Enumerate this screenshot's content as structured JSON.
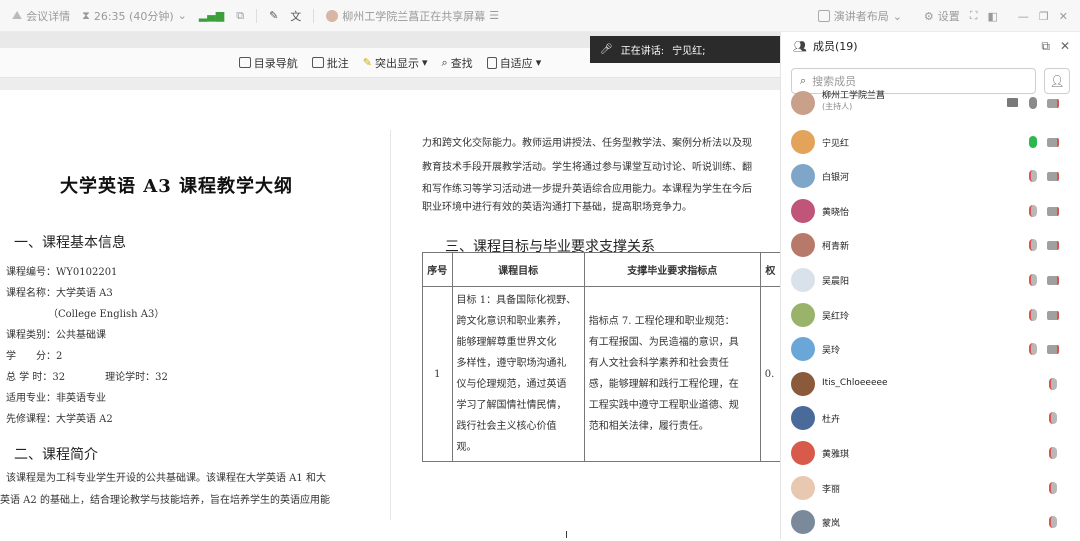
{
  "topbar": {
    "meeting_details": "会议详情",
    "timer": "26:35 (40分钟)",
    "sharing_status": "柳州工学院兰菖正在共享屏幕",
    "presenter_layout": "演讲者布局",
    "settings": "设置"
  },
  "doc_toolbar": {
    "nav": "目录导航",
    "annotate": "批注",
    "highlight": "突出显示",
    "find": "查找",
    "fit": "自适应"
  },
  "speaking": {
    "label": "正在讲话:",
    "name": "宁见红;"
  },
  "document": {
    "title": "大学英语 A3 课程教学大纲",
    "section1": "一、课程基本信息",
    "code": "课程编号：WY0102201",
    "name": "课程名称：大学英语 A3",
    "name_en": "（College English A3）",
    "category": "课程类别：公共基础课",
    "credits": "学　　分：2",
    "hours": "总 学 时：32　　　　理论学时：32",
    "major": "适用专业：非英语专业",
    "prereq": "先修课程：大学英语 A2",
    "section2": "二、课程简介",
    "intro1": "该课程是为工科专业学生开设的公共基础课。该课程在大学英语 A1 和大",
    "intro2": "英语 A2 的基础上，结合理论教学与技能培养，旨在培养学生的英语应用能",
    "right1": "力和跨文化交际能力。教师运用讲授法、任务型教学法、案例分析法以及现",
    "right2": "教育技术手段开展教学活动。学生将通过参与课堂互动讨论、听说训练、翻",
    "right3": "和写作练习等学习活动进一步提升英语综合应用能力。本课程为学生在今后",
    "right4": "职业环境中进行有效的英语沟通打下基础，提高职场竞争力。",
    "section3": "三、课程目标与毕业要求支撑关系",
    "table": {
      "h_no": "序号",
      "h_goal": "课程目标",
      "h_req": "支撑毕业要求指标点",
      "h_w": "权",
      "no": "1",
      "goal_lines": [
        "目标 1：具备国际化视野、",
        "跨文化意识和职业素养，",
        "能够理解尊重世界文化",
        "多样性，遵守职场沟通礼",
        "仪与伦理规范，通过英语",
        "学习了解国情社情民情，",
        "践行社会主义核心价值",
        "观。"
      ],
      "req_lines": [
        "指标点 7. 工程伦理和职业规范：",
        "有工程报国、为民造福的意识，具",
        "有人文社会科学素养和社会责任",
        "感，能够理解和践行工程伦理，在",
        "工程实践中遵守工程职业道德、规",
        "范和相关法律，履行责任。"
      ],
      "weight": "0."
    }
  },
  "members_panel": {
    "title": "成员(19)",
    "search_placeholder": "搜索成员",
    "members": [
      {
        "name": "柳州工学院兰菖",
        "sub": "(主持人)",
        "color": "#c9a08a"
      },
      {
        "name": "宁见红",
        "color": "#e3a35a"
      },
      {
        "name": "白银河",
        "color": "#7fa6c8"
      },
      {
        "name": "黄晓怡",
        "color": "#c0557a"
      },
      {
        "name": "柯青新",
        "color": "#b77a6a"
      },
      {
        "name": "吴晨阳",
        "color": "#d9e2ea"
      },
      {
        "name": "吴红玲",
        "color": "#9ab36a"
      },
      {
        "name": "吴玲",
        "color": "#6aa7d8"
      },
      {
        "name": "Itis_Chloeeeee",
        "color": "#8a5a3a"
      },
      {
        "name": "杜卉",
        "color": "#4a6a9a"
      },
      {
        "name": "黄雅琪",
        "color": "#d85a4a"
      },
      {
        "name": "李丽",
        "color": "#e8c8b0"
      },
      {
        "name": "蒙岚",
        "color": "#7a8a9a"
      }
    ]
  },
  "colors": {
    "mic_on": "#2db84d",
    "muted": "#d9534f",
    "dark_bar": "#2b2b2b"
  }
}
